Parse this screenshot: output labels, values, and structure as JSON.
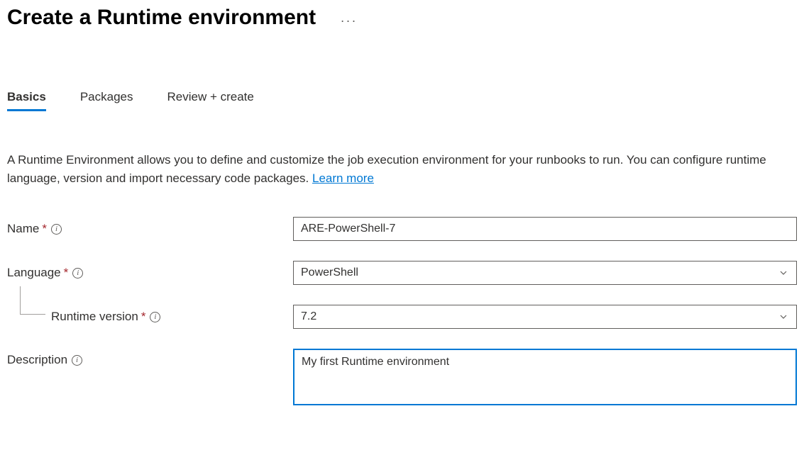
{
  "header": {
    "title": "Create a Runtime environment"
  },
  "tabs": [
    {
      "label": "Basics",
      "active": true
    },
    {
      "label": "Packages",
      "active": false
    },
    {
      "label": "Review + create",
      "active": false
    }
  ],
  "intro": {
    "text": "A Runtime Environment allows you to define and customize the job execution environment for your runbooks to run. You can configure runtime language, version and import necessary code packages. ",
    "learn_more": "Learn more"
  },
  "form": {
    "name": {
      "label": "Name",
      "value": "ARE-PowerShell-7",
      "required": true
    },
    "language": {
      "label": "Language",
      "value": "PowerShell",
      "required": true
    },
    "runtime_version": {
      "label": "Runtime version",
      "value": "7.2",
      "required": true
    },
    "description": {
      "label": "Description",
      "value": "My first Runtime environment",
      "required": false
    }
  }
}
